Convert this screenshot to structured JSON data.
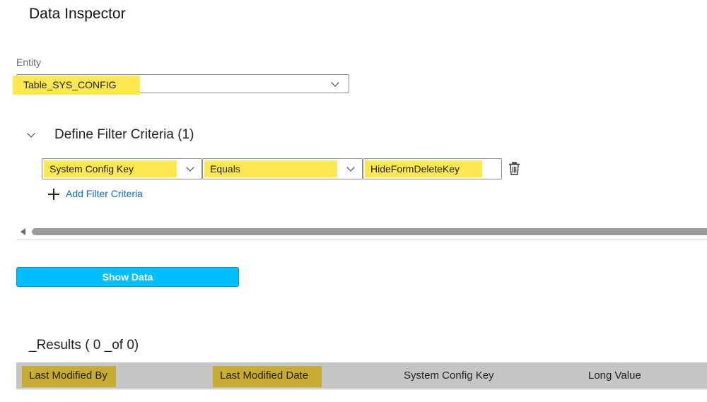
{
  "page": {
    "title": "Data Inspector"
  },
  "entity": {
    "label": "Entity",
    "value": "Table_SYS_CONFIG"
  },
  "filters": {
    "title": "Define Filter Criteria (1)",
    "criteria": [
      {
        "field": "System Config Key",
        "operator": "Equals",
        "value": "HideFormDeleteKey"
      }
    ],
    "add_label": "Add Filter Criteria"
  },
  "actions": {
    "show_data_label": "Show Data"
  },
  "results": {
    "title": "_Results ( 0 _of 0)",
    "columns": [
      "Last Modified By",
      "Last Modified Date",
      "System Config Key",
      "Long Value"
    ]
  },
  "icons": {
    "collapse": "chevron-down-icon",
    "dropdown": "chevron-down-icon",
    "delete": "trash-icon",
    "add": "plus-icon",
    "scroll_left": "arrow-left-icon"
  },
  "colors": {
    "highlight_yellow": "#fde84f",
    "highlight_olive": "#c8ac31",
    "button": "#00bfff",
    "link": "#0a6ed1",
    "table_header": "#c5c5c5"
  }
}
